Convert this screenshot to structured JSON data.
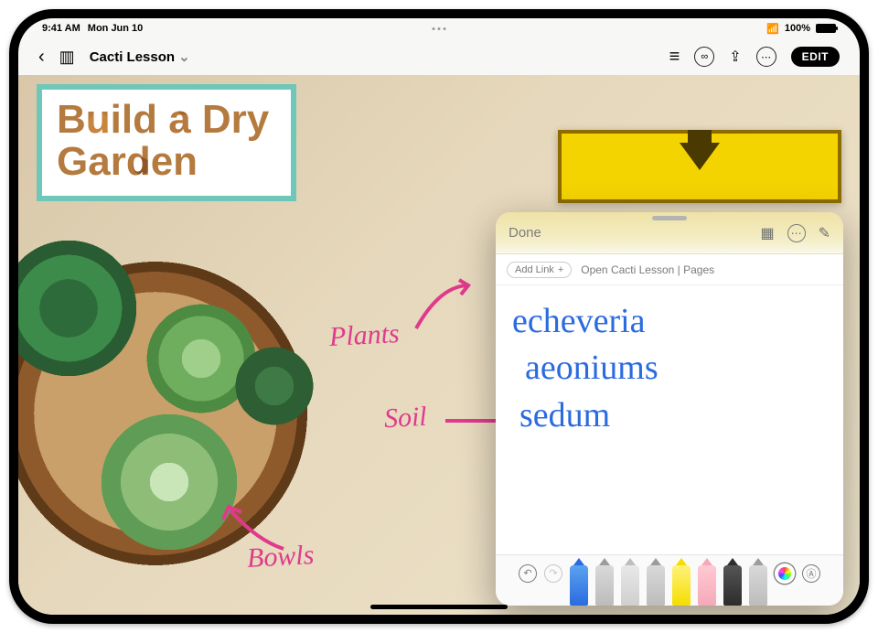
{
  "status": {
    "time": "9:41 AM",
    "date": "Mon Jun 10",
    "battery_pct": "100%"
  },
  "toolbar": {
    "doc_title": "Cacti Lesson",
    "edit_label": "EDIT"
  },
  "document": {
    "title_line1": "Build a Dry",
    "title_line2": "Garden",
    "annotations": {
      "plants": "Plants",
      "soil": "Soil",
      "bowls": "Bowls"
    }
  },
  "note": {
    "done_label": "Done",
    "add_link_label": "Add Link",
    "open_link_label": "Open Cacti Lesson | Pages",
    "lines": [
      "echeveria",
      "aeoniums",
      "sedum"
    ]
  },
  "icons": {
    "back": "‹",
    "sidebar": "▥",
    "chevron_down": "⌄",
    "list": "≡",
    "collab": "∞",
    "share": "⇪",
    "more": "⋯",
    "wifi": "📶",
    "grid": "▦",
    "compose": "✎",
    "undo": "↶",
    "redo": "↷",
    "plus": "+",
    "apple_pencil": "Ⓐ"
  }
}
